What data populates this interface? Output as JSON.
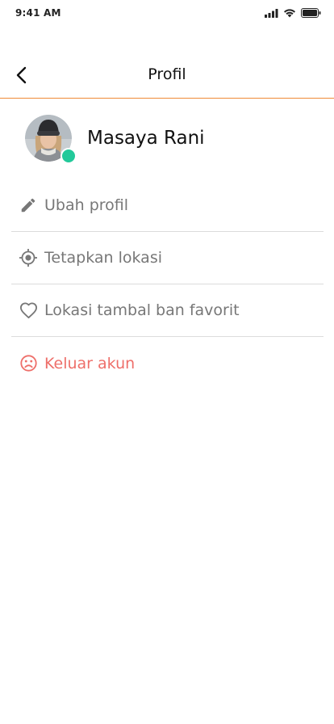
{
  "status_bar": {
    "time": "9:41 AM",
    "icons": [
      "signal-icon",
      "wifi-icon",
      "battery-icon"
    ]
  },
  "header": {
    "title": "Profil",
    "back_icon": "chevron-left-icon",
    "accent_color": "#ef8a36"
  },
  "profile": {
    "name": "Masaya Rani",
    "status": "online",
    "status_color": "#22c99a"
  },
  "menu": {
    "items": [
      {
        "label": "Ubah profil",
        "icon": "pencil-icon"
      },
      {
        "label": "Tetapkan lokasi",
        "icon": "location-target-icon"
      },
      {
        "label": "Lokasi tambal ban favorit",
        "icon": "heart-icon"
      },
      {
        "label": "Keluar akun",
        "icon": "sad-face-icon",
        "color": "#ee6f6a"
      }
    ]
  }
}
